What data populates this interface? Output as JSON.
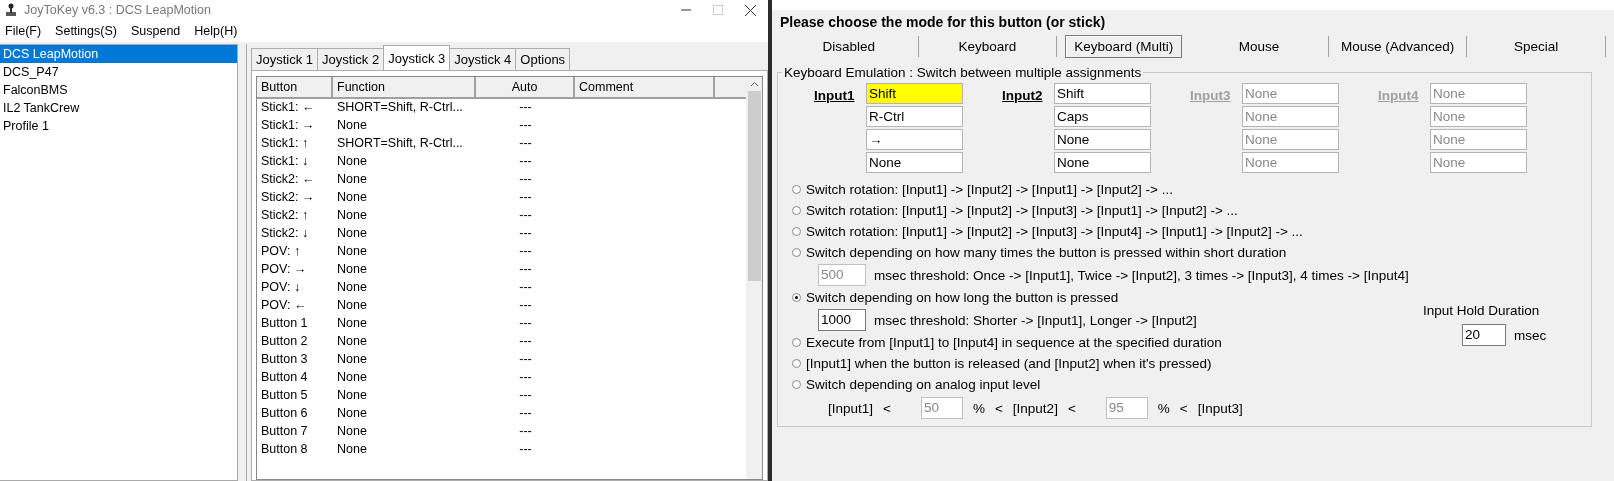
{
  "window": {
    "title": "JoyToKey v6.3 : DCS LeapMotion"
  },
  "menu": [
    "File(F)",
    "Settings(S)",
    "Suspend",
    "Help(H)"
  ],
  "profiles": [
    {
      "label": "DCS LeapMotion",
      "selected": true
    },
    {
      "label": "DCS_P47",
      "selected": false
    },
    {
      "label": "FalconBMS",
      "selected": false
    },
    {
      "label": "IL2 TankCrew",
      "selected": false
    },
    {
      "label": "Profile 1",
      "selected": false
    }
  ],
  "tabs": [
    {
      "label": "Joystick 1",
      "selected": false
    },
    {
      "label": "Joystick 2",
      "selected": false
    },
    {
      "label": "Joystick 3",
      "selected": true
    },
    {
      "label": "Joystick 4",
      "selected": false
    },
    {
      "label": "Options",
      "selected": false
    }
  ],
  "table": {
    "columns": [
      "Button",
      "Function",
      "Auto",
      "Comment"
    ],
    "rows": [
      {
        "button": "Stick1: ←",
        "function": "SHORT=Shift, R-Ctrl...",
        "auto": "---"
      },
      {
        "button": "Stick1: →",
        "function": "None",
        "auto": "---"
      },
      {
        "button": "Stick1: ↑",
        "function": "SHORT=Shift, R-Ctrl...",
        "auto": "---"
      },
      {
        "button": "Stick1: ↓",
        "function": "None",
        "auto": "---"
      },
      {
        "button": "Stick2: ←",
        "function": "None",
        "auto": "---"
      },
      {
        "button": "Stick2: →",
        "function": "None",
        "auto": "---"
      },
      {
        "button": "Stick2: ↑",
        "function": "None",
        "auto": "---"
      },
      {
        "button": "Stick2: ↓",
        "function": "None",
        "auto": "---"
      },
      {
        "button": "POV: ↑",
        "function": "None",
        "auto": "---"
      },
      {
        "button": "POV: →",
        "function": "None",
        "auto": "---"
      },
      {
        "button": "POV: ↓",
        "function": "None",
        "auto": "---"
      },
      {
        "button": "POV: ←",
        "function": "None",
        "auto": "---"
      },
      {
        "button": "Button 1",
        "function": "None",
        "auto": "---"
      },
      {
        "button": "Button 2",
        "function": "None",
        "auto": "---"
      },
      {
        "button": "Button 3",
        "function": "None",
        "auto": "---"
      },
      {
        "button": "Button 4",
        "function": "None",
        "auto": "---"
      },
      {
        "button": "Button 5",
        "function": "None",
        "auto": "---"
      },
      {
        "button": "Button 6",
        "function": "None",
        "auto": "---"
      },
      {
        "button": "Button 7",
        "function": "None",
        "auto": "---"
      },
      {
        "button": "Button 8",
        "function": "None",
        "auto": "---"
      }
    ]
  },
  "dialog": {
    "heading": "Please choose the mode for this button (or stick)",
    "modes": [
      {
        "label": "Disabled",
        "selected": false
      },
      {
        "label": "Keyboard",
        "selected": false
      },
      {
        "label": "Keyboard (Multi)",
        "selected": true
      },
      {
        "label": "Mouse",
        "selected": false
      },
      {
        "label": "Mouse (Advanced)",
        "selected": false
      },
      {
        "label": "Special",
        "selected": false
      }
    ],
    "group_title": "Keyboard Emulation : Switch between multiple assignments",
    "inputs": [
      {
        "label": "Input1",
        "disabled": false,
        "values": [
          {
            "text": "Shift",
            "highlighted": true
          },
          {
            "text": "R-Ctrl",
            "highlighted": false
          },
          {
            "text": "→",
            "highlighted": false
          },
          {
            "text": "None",
            "highlighted": false
          }
        ]
      },
      {
        "label": "Input2",
        "disabled": false,
        "values": [
          {
            "text": "Shift",
            "highlighted": false
          },
          {
            "text": "Caps",
            "highlighted": false
          },
          {
            "text": "None",
            "highlighted": false
          },
          {
            "text": "None",
            "highlighted": false
          }
        ]
      },
      {
        "label": "Input3",
        "disabled": true,
        "values": [
          {
            "text": "None",
            "highlighted": false
          },
          {
            "text": "None",
            "highlighted": false
          },
          {
            "text": "None",
            "highlighted": false
          },
          {
            "text": "None",
            "highlighted": false
          }
        ]
      },
      {
        "label": "Input4",
        "disabled": true,
        "values": [
          {
            "text": "None",
            "highlighted": false
          },
          {
            "text": "None",
            "highlighted": false
          },
          {
            "text": "None",
            "highlighted": false
          },
          {
            "text": "None",
            "highlighted": false
          }
        ]
      }
    ],
    "options": [
      {
        "label": "Switch rotation: [Input1] -> [Input2] -> [Input1] -> [Input2] -> ...",
        "selected": false
      },
      {
        "label": "Switch rotation: [Input1] -> [Input2] -> [Input3] -> [Input1] -> [Input2] -> ...",
        "selected": false
      },
      {
        "label": "Switch rotation: [Input1] -> [Input2] -> [Input3] -> [Input4] -> [Input1] -> [Input2] -> ...",
        "selected": false
      },
      {
        "label": "Switch depending on how many times the button is pressed within short duration",
        "selected": false,
        "detail": {
          "value": "500",
          "disabled": true,
          "text": "msec threshold: Once -> [Input1], Twice -> [Input2], 3 times -> [Input3], 4 times -> [Input4]"
        }
      },
      {
        "label": "Switch depending on how long the button is pressed",
        "selected": true,
        "detail": {
          "value": "1000",
          "disabled": false,
          "text": "msec threshold: Shorter -> [Input1], Longer -> [Input2]"
        }
      },
      {
        "label": "Execute from [Input1] to [Input4] in sequence at the specified duration",
        "selected": false
      },
      {
        "label": "[Input1] when the button is released (and [Input2] when it's pressed)",
        "selected": false
      },
      {
        "label": "Switch depending on analog input level",
        "selected": false,
        "analog": [
          {
            "kind": "text",
            "text": "[Input1]"
          },
          {
            "kind": "text",
            "text": "<"
          },
          {
            "kind": "field",
            "text": "50",
            "disabled": true
          },
          {
            "kind": "text",
            "text": "%"
          },
          {
            "kind": "text",
            "text": "<"
          },
          {
            "kind": "text",
            "text": "[Input2]"
          },
          {
            "kind": "text",
            "text": "<"
          },
          {
            "kind": "field",
            "text": "95",
            "disabled": true
          },
          {
            "kind": "text",
            "text": "%"
          },
          {
            "kind": "text",
            "text": "<"
          },
          {
            "kind": "text",
            "text": "[Input3]"
          }
        ]
      }
    ],
    "hold": {
      "label": "Input Hold Duration",
      "value": "20",
      "unit": "msec"
    }
  }
}
